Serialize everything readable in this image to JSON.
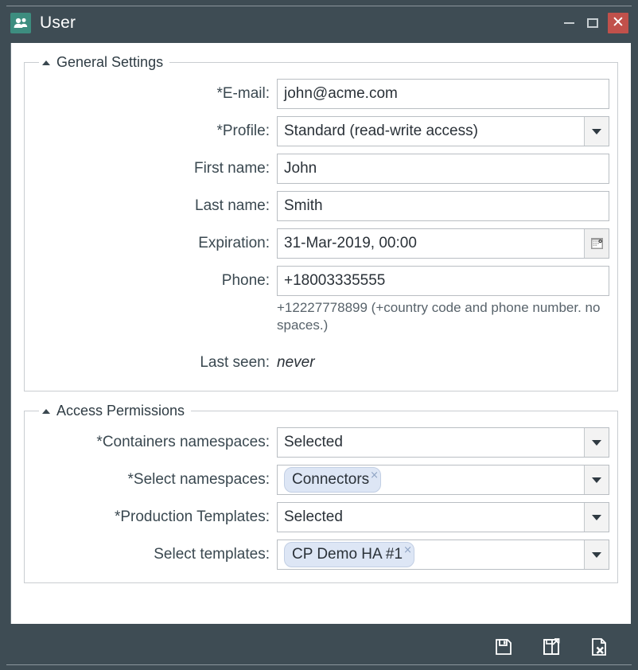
{
  "window": {
    "title": "User",
    "app_icon": "users-icon",
    "controls": {
      "minimize": "Minimize",
      "maximize": "Maximize",
      "close": "Close"
    },
    "close_color": "#c1514b",
    "titlebar_color": "#3e4c54",
    "accent_color": "#3d8d7f"
  },
  "general_settings": {
    "legend": "General Settings",
    "fields": {
      "email": {
        "label": "*E-mail:",
        "value": "john@acme.com"
      },
      "profile": {
        "label": "*Profile:",
        "value": "Standard (read-write access)"
      },
      "first_name": {
        "label": "First name:",
        "value": "John"
      },
      "last_name": {
        "label": "Last name:",
        "value": "Smith"
      },
      "expiration": {
        "label": "Expiration:",
        "value": "31-Mar-2019, 00:00"
      },
      "phone": {
        "label": "Phone:",
        "value": "+18003335555",
        "hint": "+12227778899 (+country code and phone number. no spaces.)"
      },
      "last_seen": {
        "label": "Last seen:",
        "value": "never"
      }
    }
  },
  "access_permissions": {
    "legend": "Access Permissions",
    "fields": {
      "containers_namespaces": {
        "label": "*Containers namespaces:",
        "value": "Selected"
      },
      "select_namespaces": {
        "label": "*Select namespaces:",
        "chips": [
          "Connectors"
        ]
      },
      "production_templates": {
        "label": "*Production Templates:",
        "value": "Selected"
      },
      "select_templates": {
        "label": "Select templates:",
        "chips": [
          "CP Demo HA #1"
        ]
      }
    },
    "chip_remove_glyph": "×",
    "chip_color": "#dde6f5"
  },
  "toolbar": {
    "save": "Save",
    "save_and_close": "Save and close",
    "cancel": "Cancel"
  }
}
